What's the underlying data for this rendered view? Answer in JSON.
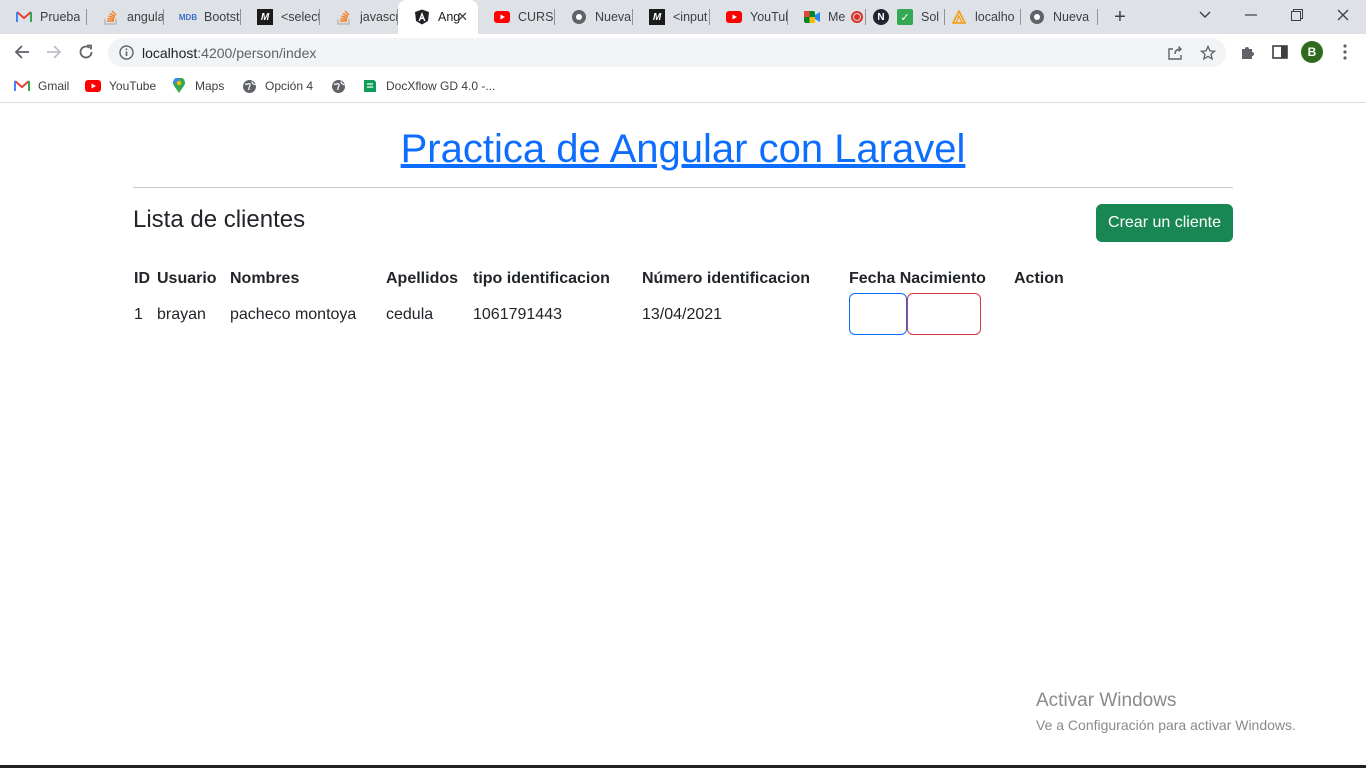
{
  "browser": {
    "tabs": [
      {
        "title": "Prueba",
        "icon": "gmail-icon"
      },
      {
        "title": "angular",
        "icon": "stackoverflow-icon"
      },
      {
        "title": "Bootstr",
        "icon": "mdb-icon"
      },
      {
        "title": "<select",
        "icon": "m-icon"
      },
      {
        "title": "javascri",
        "icon": "stackoverflow-icon"
      },
      {
        "title": "Ang",
        "icon": "angular-icon",
        "active": true
      },
      {
        "title": "CURSO",
        "icon": "youtube-icon"
      },
      {
        "title": "Nueva",
        "icon": "chrome-icon"
      },
      {
        "title": "<input",
        "icon": "m-icon"
      },
      {
        "title": "YouTub",
        "icon": "youtube-icon"
      },
      {
        "title": "Me",
        "icon": "meet-icon"
      },
      {
        "title": "",
        "icon": "n-icon"
      },
      {
        "title": "Sol",
        "icon": "check-icon"
      },
      {
        "title": "localho",
        "icon": "phpmyadmin-icon"
      },
      {
        "title": "Nueva",
        "icon": "chrome-icon"
      }
    ],
    "address": {
      "host": "localhost",
      "path": ":4200/person/index"
    },
    "profile_initial": "B",
    "bookmarks": [
      {
        "label": "Gmail",
        "icon": "gmail-icon"
      },
      {
        "label": "YouTube",
        "icon": "youtube-icon"
      },
      {
        "label": "Maps",
        "icon": "maps-icon"
      },
      {
        "label": "Opción 4",
        "icon": "globe-icon"
      },
      {
        "label": "",
        "icon": "globe-icon"
      },
      {
        "label": "DocXflow GD 4.0 -...",
        "icon": "docxflow-icon"
      }
    ]
  },
  "page": {
    "title": "Practica de Angular con Laravel",
    "subtitle": "Lista de clientes",
    "create_button": "Crear un cliente",
    "table": {
      "headers": [
        "ID",
        "Usuario",
        "Nombres",
        "Apellidos",
        "tipo identificacion",
        "Número identificacion",
        "Fecha Nacimiento",
        "Action"
      ],
      "rows": [
        [
          "1",
          "brayan",
          "pacheco montoya",
          "cedula",
          "1061791443",
          "13/04/2021",
          ""
        ]
      ]
    }
  },
  "watermark": {
    "line1": "Activar Windows",
    "line2": "Ve a Configuración para activar Windows."
  },
  "colors": {
    "link": "#0d6efd",
    "success": "#198754",
    "danger": "#dc3545"
  }
}
